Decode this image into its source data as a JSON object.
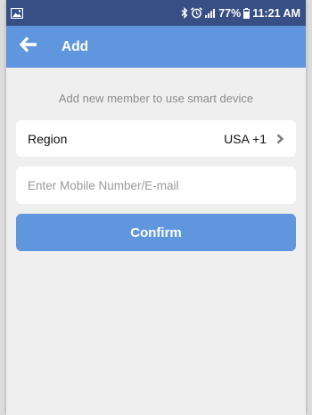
{
  "status_bar": {
    "battery": "77%",
    "time": "11:21 AM",
    "icons": [
      "gallery-icon",
      "bluetooth-icon",
      "alarm-icon",
      "signal-icon",
      "battery-icon"
    ]
  },
  "header": {
    "title": "Add",
    "back_icon": "back-arrow-icon"
  },
  "main": {
    "subtitle": "Add new member to use smart device",
    "region": {
      "label": "Region",
      "value": "USA +1",
      "icon": "chevron-right-icon"
    },
    "contact_input": {
      "value": "",
      "placeholder": "Enter Mobile Number/E-mail"
    },
    "confirm_label": "Confirm"
  },
  "colors": {
    "status_bar": "#374f84",
    "app_bar": "#6096de",
    "background": "#efeff0",
    "button": "#6096de"
  }
}
